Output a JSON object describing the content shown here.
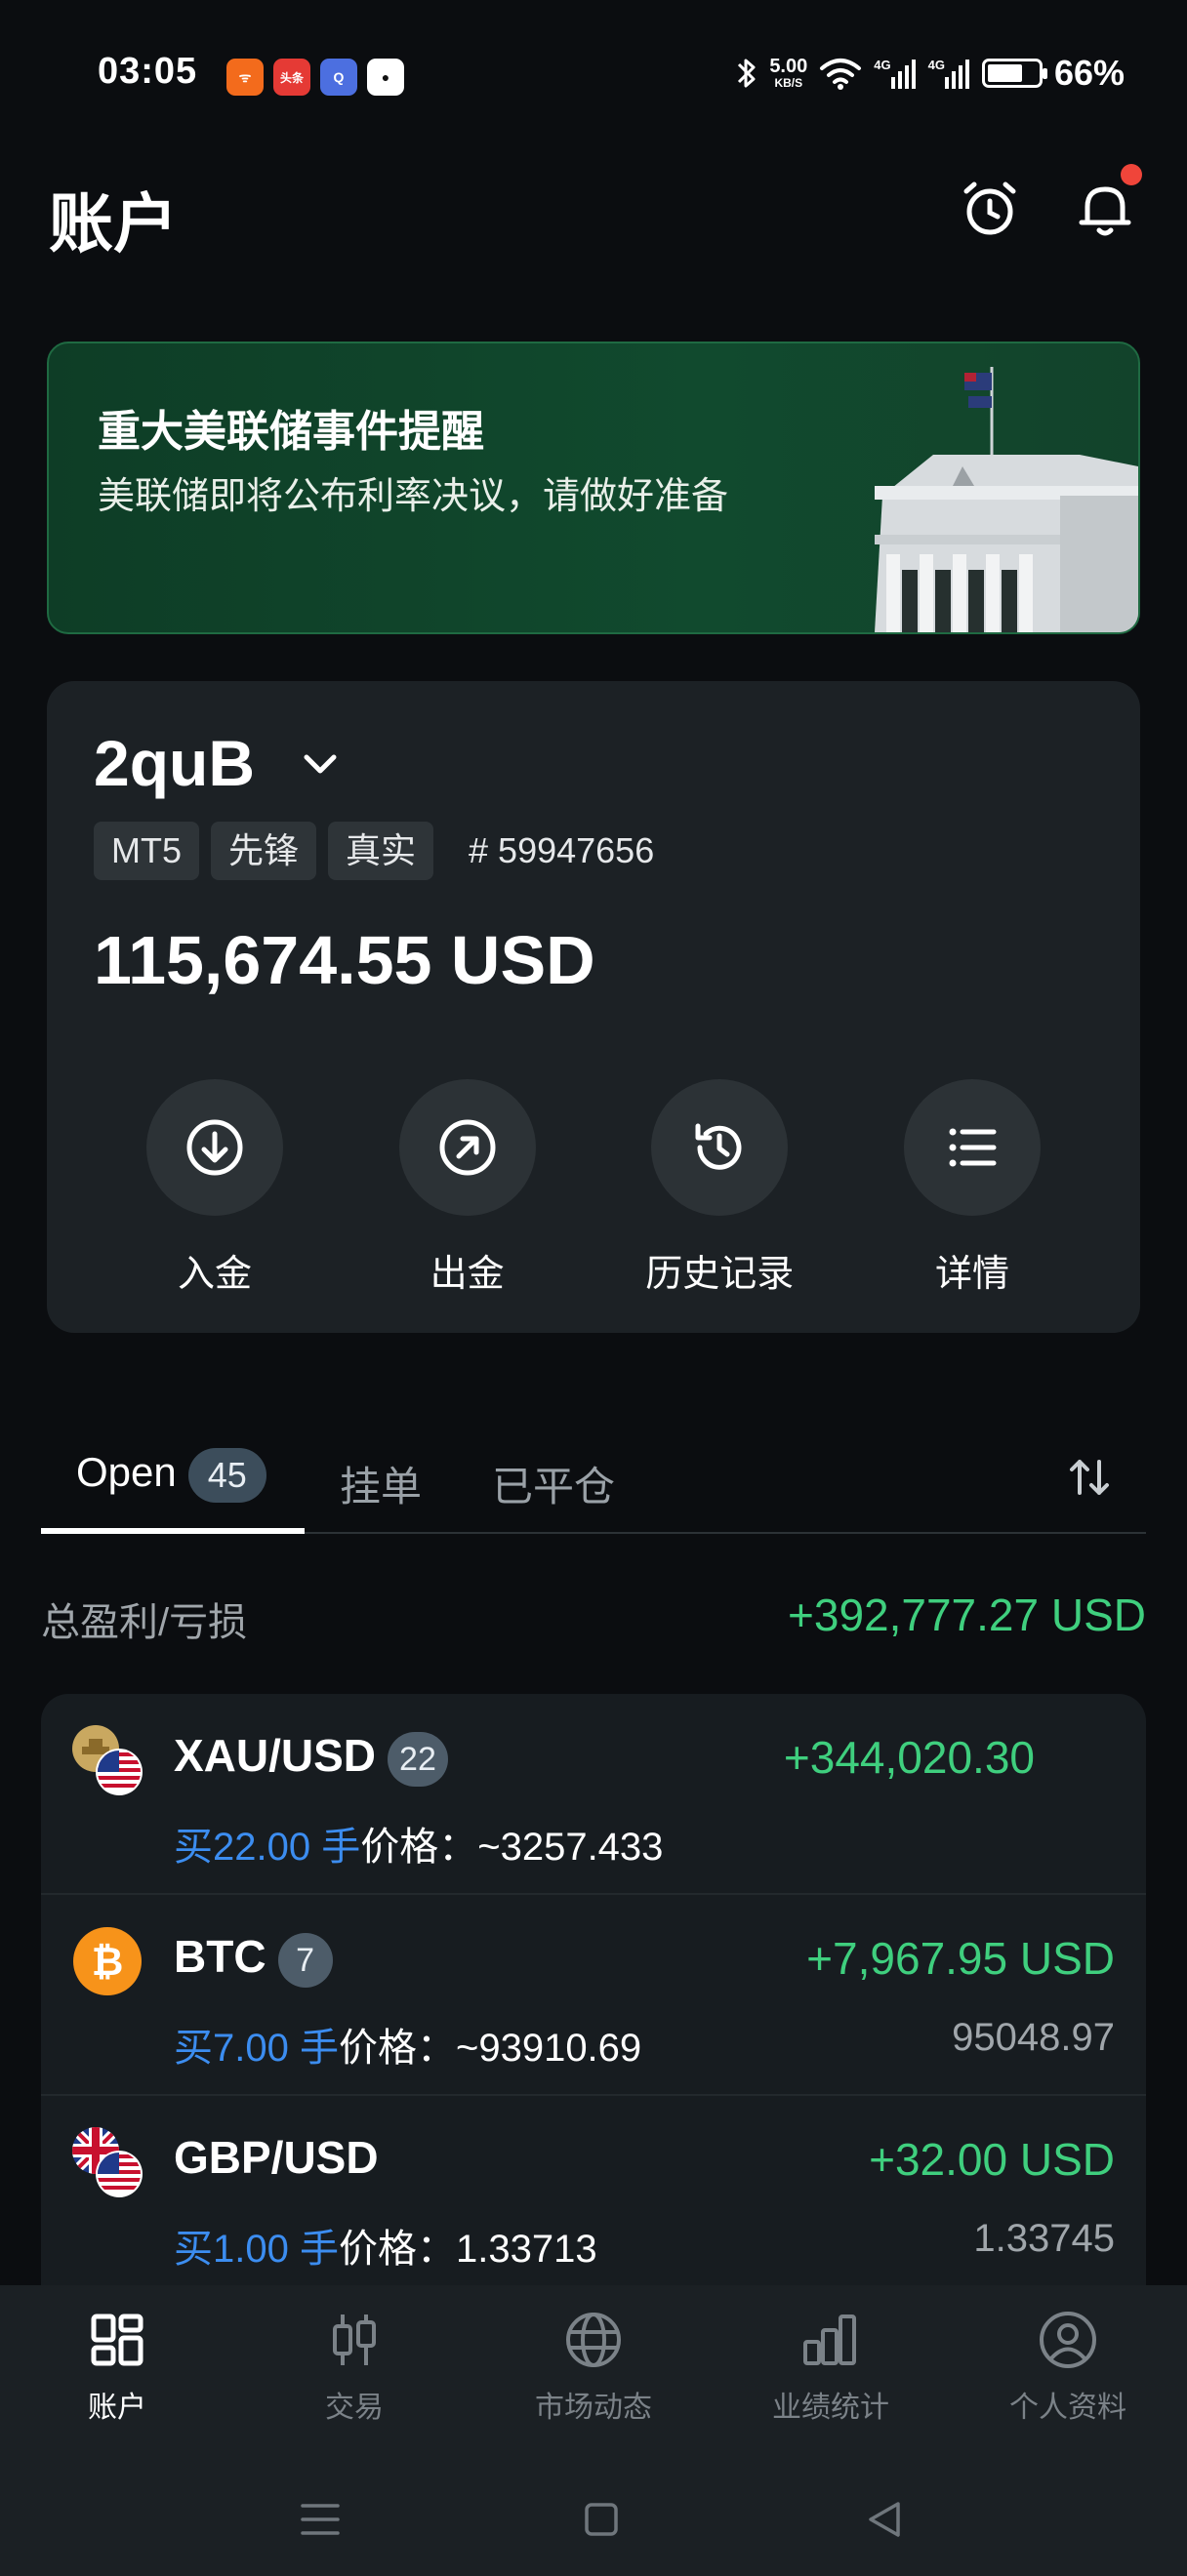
{
  "status_bar": {
    "time": "03:05",
    "net_speed_value": "5.00",
    "net_speed_unit": "KB/S",
    "signal1": "4G",
    "signal2": "4G",
    "battery": "66%",
    "apps": [
      {
        "name": "notification-app-1",
        "text": "ᯤ",
        "color": "#f36b1c"
      },
      {
        "name": "toutiao-app",
        "text": "头条",
        "color": "#e53a35"
      },
      {
        "name": "browser-app",
        "text": "Q",
        "color": "#4c6fe0"
      },
      {
        "name": "qq-app",
        "text": "●",
        "color": "#ffffff"
      }
    ]
  },
  "header": {
    "title": "账户"
  },
  "banner": {
    "title": "重大美联储事件提醒",
    "text": "美联储即将公布利率决议，请做好准备"
  },
  "account": {
    "name": "2quB",
    "tags": [
      "MT5",
      "先锋",
      "真实"
    ],
    "number": "# 59947656",
    "balance": "115,674.55 USD",
    "actions": [
      {
        "label": "入金",
        "icon": "deposit-icon"
      },
      {
        "label": "出金",
        "icon": "withdraw-icon"
      },
      {
        "label": "历史记录",
        "icon": "history-icon"
      },
      {
        "label": "详情",
        "icon": "details-list-icon"
      }
    ]
  },
  "tabs": {
    "open_label": "Open",
    "open_count": "45",
    "pending_label": "挂单",
    "closed_label": "已平仓"
  },
  "summary": {
    "label": "总盈利/亏损",
    "value": "+392,777.27 USD"
  },
  "positions": [
    {
      "symbol": "XAU/USD",
      "count": "22",
      "profit": "+344,020.30",
      "side": "买22.00 手",
      "price_label": "价格：",
      "price": "~3257.433",
      "current": ""
    },
    {
      "symbol": "BTC",
      "count": "7",
      "profit": "+7,967.95 USD",
      "side": "买7.00 手",
      "price_label": "价格：",
      "price": "~93910.69",
      "current": "95048.97"
    },
    {
      "symbol": "GBP/USD",
      "count": "",
      "profit": "+32.00 USD",
      "side": "买1.00 手",
      "price_label": "价格：",
      "price": "1.33713",
      "current": "1.33745"
    }
  ],
  "colors": {
    "profit": "#3fcf7e",
    "side": "#3c8df0",
    "banner": "#114a2e"
  },
  "bottom_nav": [
    {
      "label": "账户",
      "icon": "account-grid-icon",
      "active": true
    },
    {
      "label": "交易",
      "icon": "trade-candles-icon",
      "active": false
    },
    {
      "label": "市场动态",
      "icon": "globe-icon",
      "active": false
    },
    {
      "label": "业绩统计",
      "icon": "bar-chart-icon",
      "active": false
    },
    {
      "label": "个人资料",
      "icon": "profile-icon",
      "active": false
    }
  ]
}
